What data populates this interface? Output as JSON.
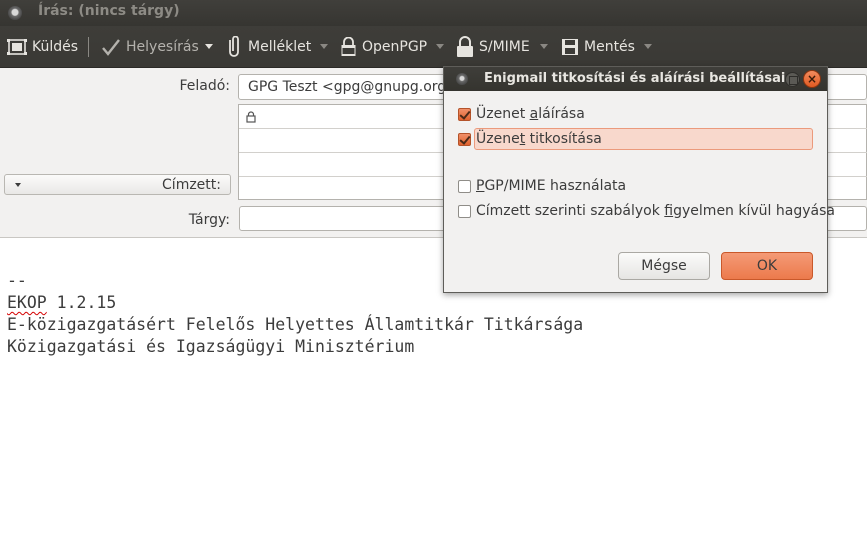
{
  "window": {
    "title": "Írás: (nincs tárgy)"
  },
  "toolbar": {
    "send": "Küldés",
    "spelling": "Helyesírás",
    "attachment": "Melléklet",
    "openpgp": "OpenPGP",
    "smime": "S/MIME",
    "save": "Mentés"
  },
  "header": {
    "from_label": "Feladó:",
    "from_value": "GPG Teszt <gpg@gnupg.org>",
    "to_label": "Címzett:",
    "subject_label": "Tárgy:",
    "subject_value": ""
  },
  "body": {
    "line1": "--",
    "line2_prefix": "EKOP",
    "line2_rest": " 1.2.15",
    "line3": "E-közigazgatásért Felelős Helyettes Államtitkár Titkársága",
    "line4": "Közigazgatási és Igazságügyi Minisztérium"
  },
  "dialog": {
    "title": "Enigmail titkosítási és aláírási beállításai",
    "options": [
      {
        "label": "Üzenet aláírása",
        "checked": true
      },
      {
        "label": "Üzenet titkosítása",
        "checked": true
      },
      {
        "label": "PGP/MIME használata",
        "checked": false
      },
      {
        "label": "Címzett szerinti szabályok figyelmen kívül hagyása",
        "checked": false
      }
    ],
    "cancel_label": "Mégse",
    "ok_label": "OK"
  },
  "colors": {
    "accent": "#ec7a4c",
    "toolbar_bg": "#3c3b37",
    "highlight": "#f8d8cc"
  },
  "icons": [
    "window-icon",
    "send-icon",
    "spelling-check-icon",
    "attachment-icon",
    "openpgp-icon",
    "smime-lock-icon",
    "save-disk-icon",
    "lock-icon",
    "close-icon",
    "restore-icon"
  ]
}
